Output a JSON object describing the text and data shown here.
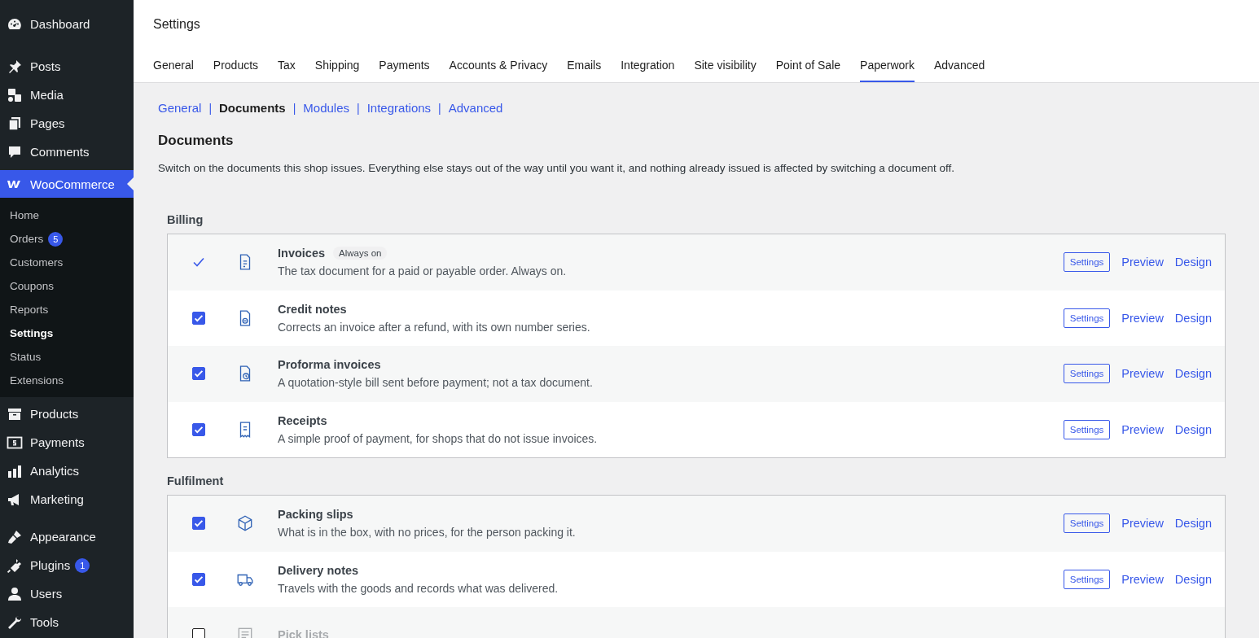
{
  "sidebar": {
    "groups": [
      [
        {
          "label": "Dashboard",
          "selected": false
        }
      ],
      [
        {
          "label": "Posts",
          "selected": false
        },
        {
          "label": "Media",
          "selected": false
        },
        {
          "label": "Pages",
          "selected": false
        },
        {
          "label": "Comments",
          "selected": false
        }
      ],
      [
        {
          "label": "WooCommerce",
          "selected": true,
          "expanded": true,
          "children": [
            {
              "label": "Home",
              "selected": false
            },
            {
              "label": "Orders",
              "selected": false,
              "badge": "5"
            },
            {
              "label": "Customers",
              "selected": false
            },
            {
              "label": "Coupons",
              "selected": false
            },
            {
              "label": "Reports",
              "selected": false
            },
            {
              "label": "Settings",
              "selected": true
            },
            {
              "label": "Status",
              "selected": false
            },
            {
              "label": "Extensions",
              "selected": false
            }
          ]
        },
        {
          "label": "Products",
          "selected": false
        },
        {
          "label": "Payments",
          "selected": false
        },
        {
          "label": "Analytics",
          "selected": false
        },
        {
          "label": "Marketing",
          "selected": false
        }
      ],
      [
        {
          "label": "Appearance",
          "selected": false
        },
        {
          "label": "Plugins",
          "selected": false,
          "badge": "1"
        },
        {
          "label": "Users",
          "selected": false
        },
        {
          "label": "Tools",
          "selected": false
        }
      ]
    ]
  },
  "page_title": "Settings",
  "tabs": [
    {
      "label": "General",
      "selected": false
    },
    {
      "label": "Products",
      "selected": false
    },
    {
      "label": "Tax",
      "selected": false
    },
    {
      "label": "Shipping",
      "selected": false
    },
    {
      "label": "Payments",
      "selected": false
    },
    {
      "label": "Accounts & Privacy",
      "selected": false
    },
    {
      "label": "Emails",
      "selected": false
    },
    {
      "label": "Integration",
      "selected": false
    },
    {
      "label": "Site visibility",
      "selected": false
    },
    {
      "label": "Point of Sale",
      "selected": false
    },
    {
      "label": "Paperwork",
      "selected": true
    },
    {
      "label": "Advanced",
      "selected": false
    }
  ],
  "subnav": [
    {
      "label": "General",
      "selected": false
    },
    {
      "label": "Documents",
      "selected": true
    },
    {
      "label": "Modules",
      "selected": false
    },
    {
      "label": "Integrations",
      "selected": false
    },
    {
      "label": "Advanced",
      "selected": false
    }
  ],
  "subnav_separator": "|",
  "heading": "Documents",
  "description": "Switch on the documents this shop issues. Everything else stays out of the way until you want it, and nothing already issued is affected by switching a document off.",
  "sections": [
    {
      "title": "Billing",
      "rows": [
        {
          "kind": "fixed",
          "name": "Invoices",
          "badge": "Always on",
          "description": "The tax document for a paid or payable order. Always on.",
          "actions": [
            "Settings",
            "Preview",
            "Design"
          ]
        },
        {
          "kind": "toggle",
          "checked": true,
          "name": "Credit notes",
          "description": "Corrects an invoice after a refund, with its own number series.",
          "actions": [
            "Settings",
            "Preview",
            "Design"
          ]
        },
        {
          "kind": "toggle",
          "checked": true,
          "name": "Proforma invoices",
          "description": "A quotation-style bill sent before payment; not a tax document.",
          "actions": [
            "Settings",
            "Preview",
            "Design"
          ]
        },
        {
          "kind": "toggle",
          "checked": true,
          "name": "Receipts",
          "description": "A simple proof of payment, for shops that do not issue invoices.",
          "actions": [
            "Settings",
            "Preview",
            "Design"
          ]
        }
      ]
    },
    {
      "title": "Fulfilment",
      "rows": [
        {
          "kind": "toggle",
          "checked": true,
          "name": "Packing slips",
          "description": "What is in the box, with no prices, for the person packing it.",
          "actions": [
            "Settings",
            "Preview",
            "Design"
          ]
        },
        {
          "kind": "toggle",
          "checked": true,
          "name": "Delivery notes",
          "description": "Travels with the goods and records what was delivered.",
          "actions": [
            "Settings",
            "Preview",
            "Design"
          ]
        },
        {
          "kind": "toggle",
          "checked": false,
          "name": "Pick lists"
        }
      ]
    }
  ]
}
